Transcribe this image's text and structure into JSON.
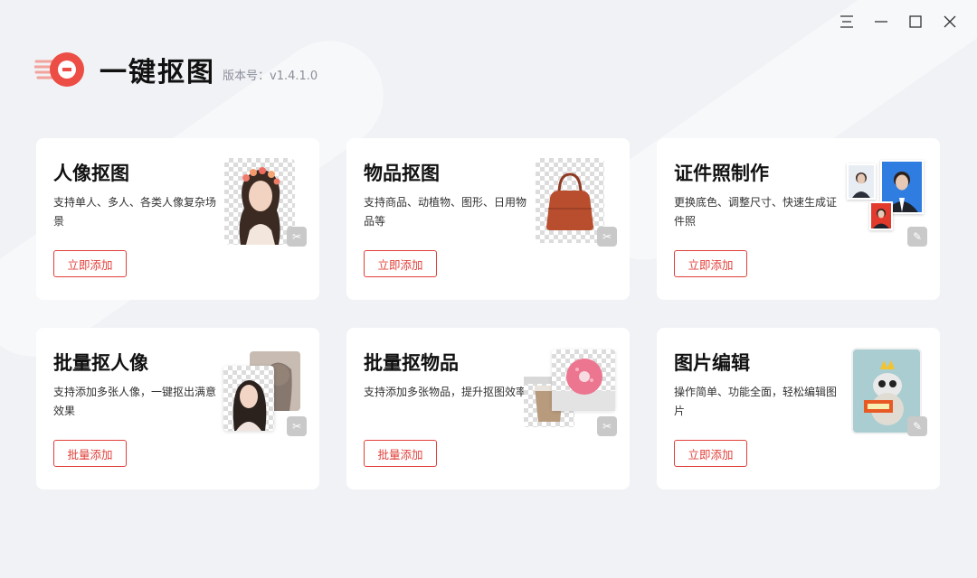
{
  "app": {
    "title": "一键抠图",
    "version": "版本号：v1.4.1.0"
  },
  "window_controls": [
    {
      "name": "menu-icon",
      "glyph": "☰"
    },
    {
      "name": "minimize-icon",
      "glyph": "—"
    },
    {
      "name": "maximize-icon",
      "glyph": "☐"
    },
    {
      "name": "close-icon",
      "glyph": "✕"
    }
  ],
  "cards": [
    {
      "title": "人像抠图",
      "desc": "支持单人、多人、各类人像复杂场景",
      "button": "立即添加",
      "badge_icon": "scissors-icon"
    },
    {
      "title": "物品抠图",
      "desc": "支持商品、动植物、图形、日用物品等",
      "button": "立即添加",
      "badge_icon": "scissors-icon"
    },
    {
      "title": "证件照制作",
      "desc": "更换底色、调整尺寸、快速生成证件照",
      "button": "立即添加",
      "badge_icon": "pencil-icon"
    },
    {
      "title": "批量抠人像",
      "desc": "支持添加多张人像，一键抠出满意效果",
      "button": "批量添加",
      "badge_icon": "scissors-icon"
    },
    {
      "title": "批量抠物品",
      "desc": "支持添加多张物品，提升抠图效率",
      "button": "批量添加",
      "badge_icon": "scissors-icon"
    },
    {
      "title": "图片编辑",
      "desc": "操作简单、功能全面，轻松编辑图片",
      "button": "立即添加",
      "badge_icon": "pencil-icon"
    }
  ],
  "colors": {
    "accent": "#e0403a",
    "background": "#f1f2f5",
    "card": "#ffffff",
    "id_blue": "#2f7de0"
  }
}
